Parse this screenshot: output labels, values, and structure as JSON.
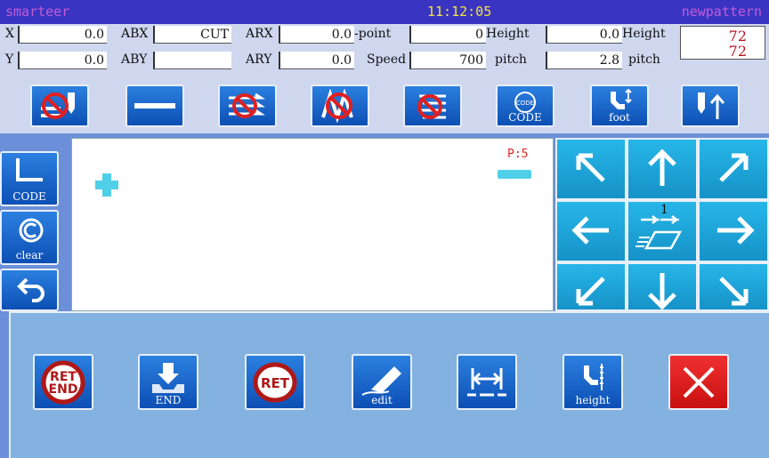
{
  "titlebar": {
    "app": "smarteer",
    "time": "11:12:05",
    "pattern": "newpattern"
  },
  "info": {
    "x_label": "X",
    "x_value": "0.0",
    "y_label": "Y",
    "y_value": "0.0",
    "abx_label": "ABX",
    "abx_value": "CUT",
    "aby_label": "ABY",
    "aby_value": "",
    "arx_label": "ARX",
    "arx_value": "0.0",
    "ary_label": "ARY",
    "ary_value": "0.0",
    "point_label": "-point",
    "point_value": "0",
    "speed_label": "Speed",
    "speed_value": "700",
    "height_label": "Height",
    "height_value": "0.0",
    "pitch_label": "pitch",
    "pitch_value": "2.8",
    "height2_label": "Height",
    "height2_value": "72",
    "pitch2_label": "pitch",
    "pitch2_value": "72"
  },
  "toolbar": {
    "code_label": "CODE",
    "foot_label": "foot"
  },
  "left": {
    "code_label": "CODE",
    "clear_label": "clear"
  },
  "canvas": {
    "point_label": "P:5"
  },
  "pad": {
    "step": "1"
  },
  "panel": {
    "end_label": "END",
    "edit_label": "edit",
    "height_label": "height"
  },
  "colors": {
    "titlebar": "#3a34c2",
    "accent_blue": "#0d4fb4",
    "pad": "#1692c8",
    "close_red": "#e02020",
    "marker": "#4fd0e8"
  }
}
